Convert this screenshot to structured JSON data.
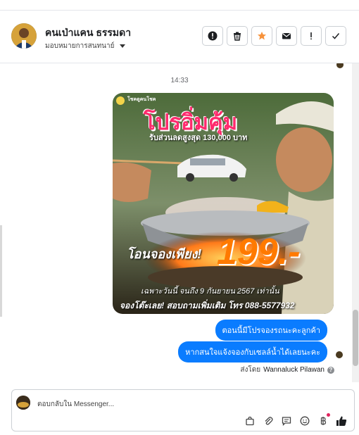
{
  "header": {
    "contact_name": "คนเป่าแคน ธรรมดา",
    "assign_label": "มอบหมายการสนทนาย์",
    "actions": [
      {
        "name": "alert-circle-icon"
      },
      {
        "name": "trash-icon"
      },
      {
        "name": "star-icon",
        "color": "#f7923b"
      },
      {
        "name": "mail-icon"
      },
      {
        "name": "exclamation-icon"
      },
      {
        "name": "check-icon"
      }
    ]
  },
  "thread": {
    "timestamp": "14:33",
    "image": {
      "brand": "โชคดูคนโชค",
      "headline": "โปรอิ่มคุ้ม",
      "subheadline": "รับส่วนลดสูงสุด 130,000 บาท",
      "transfer_text": "โอนจองเพียง!",
      "price": "199.-",
      "date_text": "เฉพาะวันนี้ จนถึง 9 กันยายน 2567 เท่านั้น",
      "contact_text": "จองโต๊ะเลย! สอบถามเพิ่มเติม โทร 088-5577932",
      "colors": {
        "headline": "#ff2a6d",
        "price": "#ff7a00"
      }
    },
    "messages": [
      {
        "text": "ตอนนี้มีโปรจองรถนะคะลูกค้า"
      },
      {
        "text": "หากสนใจแจ้งจองกับเซลล์น้ำได้เลยนะคะ"
      }
    ],
    "sent_by_prefix": "ส่งโดย",
    "sent_by_name": "Wannaluck Pilawan",
    "help_symbol": "?"
  },
  "composer": {
    "placeholder": "ตอบกลับใน Messenger...",
    "tools": [
      "bag-icon",
      "paperclip-icon",
      "saved-reply-icon",
      "emoji-icon",
      "baht-icon",
      "thumbs-up-icon"
    ]
  },
  "colors": {
    "accent": "#0a7cff"
  }
}
